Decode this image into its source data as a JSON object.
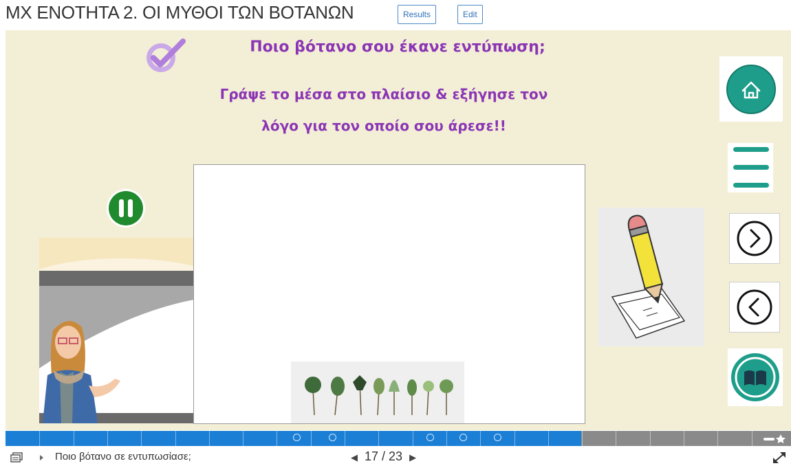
{
  "header": {
    "title": "ΜΧ ΕΝΟΤΗΤΑ 2. ΟΙ ΜΥΘΟΙ ΤΩΝ ΒΟΤΑΝΩΝ",
    "results_label": "Results",
    "edit_label": "Edit"
  },
  "slide": {
    "heading": "Ποιο βότανο σου έκανε εντύπωση;",
    "instruction_line1": "Γράψε το μέσα στο πλαίσιο & εξήγησε τον",
    "instruction_line2": "λόγο για τον οποίο σου άρεσε!!",
    "answer_box_value": ""
  },
  "icons": {
    "check": "check-circle-icon",
    "pause": "pause-icon",
    "home": "home-icon",
    "menu": "menu-icon",
    "next": "next-arrow-icon",
    "prev": "prev-arrow-icon",
    "book": "book-icon",
    "pencil": "pencil-illustration"
  },
  "progress": {
    "fraction": 0.733,
    "segments": 23,
    "answered_dots": [
      16,
      17,
      25,
      26,
      27
    ]
  },
  "footer": {
    "slide_title": "Ποιο βότανο σε εντυπωσίασε;",
    "pager_current": "17",
    "pager_sep": " / ",
    "pager_total": "23"
  },
  "colors": {
    "accent_purple": "#8b35b5",
    "teal": "#1e9e8a",
    "progress_blue": "#1b7fd6",
    "slide_bg": "#f3efd6"
  }
}
